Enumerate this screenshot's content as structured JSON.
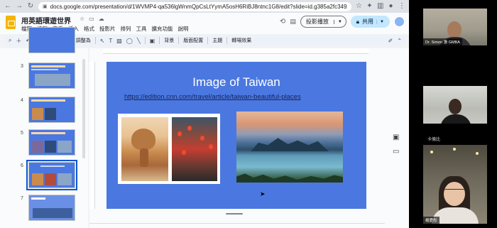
{
  "browser": {
    "url": "docs.google.com/presentation/d/1WVMP4-qa536lgWnmQpCsLtYymA5osH6RiBJ8ntnc1G8/edit?slide=id.g385a2fc3492_0_28#slide=i..."
  },
  "docs": {
    "title": "用英語環遊世界",
    "menu": [
      "檔案",
      "編輯",
      "查看",
      "插入",
      "格式",
      "投影片",
      "排列",
      "工具",
      "擴充功能",
      "說明"
    ],
    "present_label": "投影播放",
    "share_label": "共用"
  },
  "toolbar": {
    "zoom": "調整為",
    "background": "背景",
    "layout": "版面配置",
    "theme": "主題",
    "transition": "轉場效果"
  },
  "filmstrip": {
    "numbers": [
      "3",
      "4",
      "5",
      "6",
      "7"
    ],
    "selected": "6"
  },
  "slide": {
    "title": "Image of Taiwan",
    "link": "https://edition.cnn.com/travel/article/taiwan-beautiful-places"
  },
  "participants": {
    "p1_name": "Dr. Simon 張 GMBA",
    "p2_caption": "卡倫比",
    "p3_name": "楊愛彤"
  },
  "colors": {
    "slide_bg": "#4b78e0",
    "link": "#12235a",
    "accent": "#0b57d0",
    "share_bg": "#c2e7ff"
  }
}
